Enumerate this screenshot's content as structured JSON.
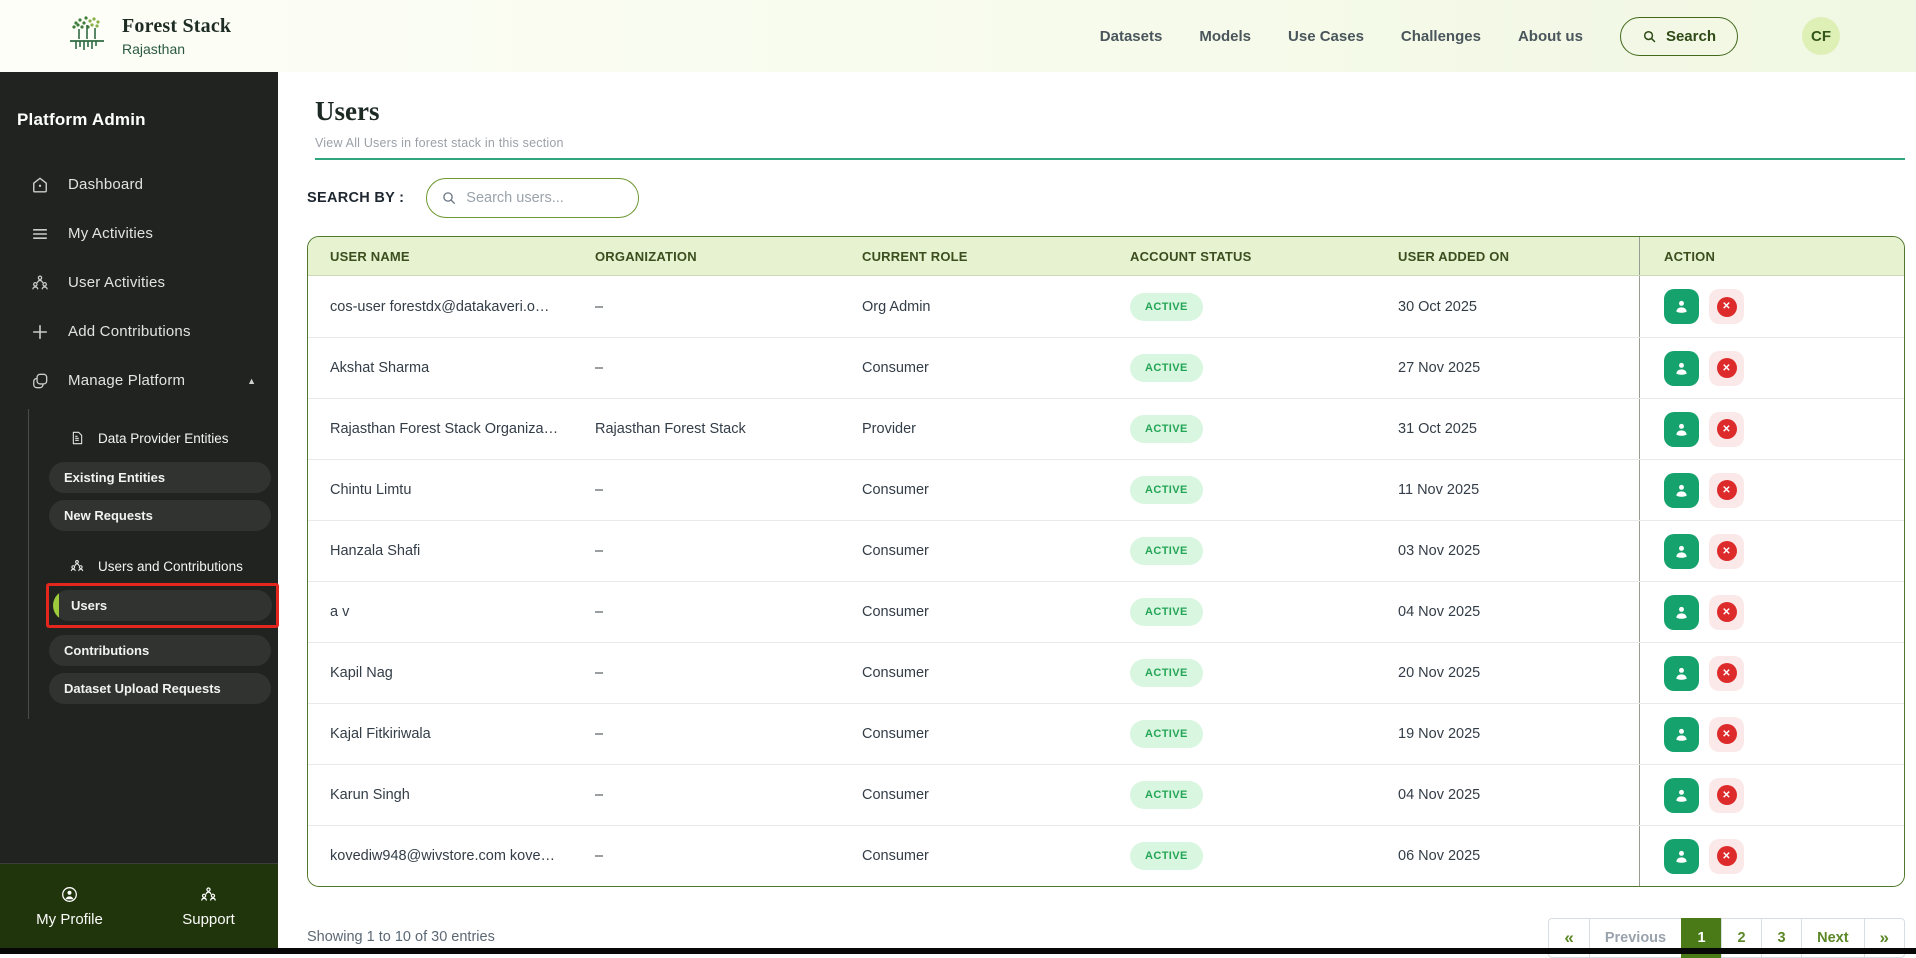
{
  "header": {
    "brand": {
      "title": "Forest Stack",
      "subtitle": "Rajasthan"
    },
    "nav": [
      "Datasets",
      "Models",
      "Use Cases",
      "Challenges",
      "About us"
    ],
    "search_button": "Search",
    "avatar_initials": "CF"
  },
  "sidebar": {
    "title": "Platform Admin",
    "items": [
      {
        "label": "Dashboard"
      },
      {
        "label": "My Activities"
      },
      {
        "label": "User Activities"
      },
      {
        "label": "Add Contributions"
      },
      {
        "label": "Manage Platform",
        "expanded": true
      }
    ],
    "submenu": {
      "data_provider_entities": "Data Provider Entities",
      "existing_entities": "Existing Entities",
      "new_requests": "New Requests",
      "users_and_contributions": "Users and Contributions",
      "users": "Users",
      "contributions": "Contributions",
      "dataset_upload_requests": "Dataset Upload Requests"
    },
    "footer": [
      {
        "label": "My Profile"
      },
      {
        "label": "Support"
      }
    ]
  },
  "main": {
    "title": "Users",
    "subtitle": "View All Users in forest stack in this section",
    "search_by": "SEARCH BY :",
    "search_placeholder": "Search users...",
    "table": {
      "columns": [
        "USER NAME",
        "ORGANIZATION",
        "CURRENT ROLE",
        "ACCOUNT STATUS",
        "USER ADDED ON",
        "ACTION"
      ],
      "rows": [
        {
          "name": "cos-user forestdx@datakaveri.o…",
          "organization": "–",
          "role": "Org Admin",
          "status": "ACTIVE",
          "added_on": "30 Oct 2025"
        },
        {
          "name": "Akshat Sharma",
          "organization": "–",
          "role": "Consumer",
          "status": "ACTIVE",
          "added_on": "27 Nov 2025"
        },
        {
          "name": "Rajasthan Forest Stack Organiza…",
          "organization": "Rajasthan Forest Stack",
          "role": "Provider",
          "status": "ACTIVE",
          "added_on": "31 Oct 2025"
        },
        {
          "name": "Chintu Limtu",
          "organization": "–",
          "role": "Consumer",
          "status": "ACTIVE",
          "added_on": "11 Nov 2025"
        },
        {
          "name": "Hanzala Shafi",
          "organization": "–",
          "role": "Consumer",
          "status": "ACTIVE",
          "added_on": "03 Nov 2025"
        },
        {
          "name": "a v",
          "organization": "–",
          "role": "Consumer",
          "status": "ACTIVE",
          "added_on": "04 Nov 2025"
        },
        {
          "name": "Kapil Nag",
          "organization": "–",
          "role": "Consumer",
          "status": "ACTIVE",
          "added_on": "20 Nov 2025"
        },
        {
          "name": "Kajal Fitkiriwala",
          "organization": "–",
          "role": "Consumer",
          "status": "ACTIVE",
          "added_on": "19 Nov 2025"
        },
        {
          "name": "Karun Singh",
          "organization": "–",
          "role": "Consumer",
          "status": "ACTIVE",
          "added_on": "04 Nov 2025"
        },
        {
          "name": "kovediw948@wivstore.com kove…",
          "organization": "–",
          "role": "Consumer",
          "status": "ACTIVE",
          "added_on": "06 Nov 2025"
        }
      ]
    },
    "footer": {
      "showing": "Showing 1 to 10 of 30 entries",
      "pagination": [
        {
          "label": "«",
          "kind": "first"
        },
        {
          "label": "Previous",
          "kind": "prev"
        },
        {
          "label": "1",
          "kind": "page",
          "active": true
        },
        {
          "label": "2",
          "kind": "page"
        },
        {
          "label": "3",
          "kind": "page"
        },
        {
          "label": "Next",
          "kind": "next"
        },
        {
          "label": "»",
          "kind": "last"
        }
      ]
    }
  },
  "colors": {
    "accent_green": "#4a7a18",
    "lime_accent": "#9ccb3b",
    "table_header_bg": "#e6f2d0",
    "table_border": "#50772b",
    "badge_bg": "#d9f6e0",
    "badge_text": "#25a557",
    "action_green": "#16a26d",
    "action_red": "#dd2b2b",
    "annotation_red": "#e3271c",
    "divider_teal": "#2fa580"
  }
}
